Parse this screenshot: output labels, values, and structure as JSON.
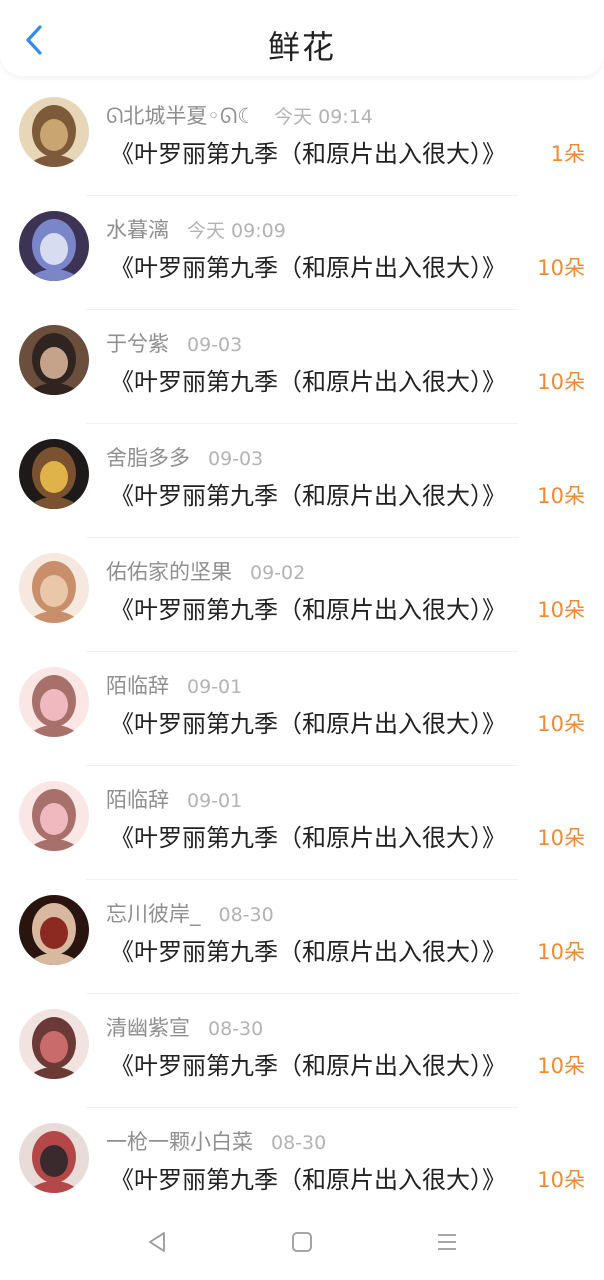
{
  "header": {
    "title": "鲜花",
    "back_icon": "chevron-left-icon",
    "accent": "#2f8cf0"
  },
  "colors": {
    "count": "#f08a33",
    "name": "#8f8f8f",
    "time": "#b3b3b3",
    "message": "#222222"
  },
  "rows": [
    {
      "name": "ᘏ北城半夏◦ᘏ☾",
      "time": "今天 09:14",
      "message": "《叶罗丽第九季（和原片出入很大）》",
      "count": "1朵",
      "avatar_palette": [
        "#e8d6b8",
        "#c9a571",
        "#7d5a3a"
      ]
    },
    {
      "name": "水暮漓",
      "time": "今天 09:09",
      "message": "《叶罗丽第九季（和原片出入很大）》",
      "count": "10朵",
      "avatar_palette": [
        "#3c3355",
        "#d7dcf0",
        "#7b86c8"
      ]
    },
    {
      "name": "于兮紫",
      "time": "09-03",
      "message": "《叶罗丽第九季（和原片出入很大）》",
      "count": "10朵",
      "avatar_palette": [
        "#6b4e3b",
        "#c4a38a",
        "#2f2420"
      ]
    },
    {
      "name": "舍脂多多",
      "time": "09-03",
      "message": "《叶罗丽第九季（和原片出入很大）》",
      "count": "10朵",
      "avatar_palette": [
        "#1f1a1a",
        "#e0b24a",
        "#7a5230"
      ]
    },
    {
      "name": "佑佑家的坚果",
      "time": "09-02",
      "message": "《叶罗丽第九季（和原片出入很大）》",
      "count": "10朵",
      "avatar_palette": [
        "#f6e8de",
        "#e9c7a8",
        "#c98f6b"
      ]
    },
    {
      "name": "陌临辞",
      "time": "09-01",
      "message": "《叶罗丽第九季（和原片出入很大）》",
      "count": "10朵",
      "avatar_palette": [
        "#fbe6e6",
        "#f0b9c0",
        "#a8706b"
      ]
    },
    {
      "name": "陌临辞",
      "time": "09-01",
      "message": "《叶罗丽第九季（和原片出入很大）》",
      "count": "10朵",
      "avatar_palette": [
        "#fbe6e6",
        "#f0b9c0",
        "#a8706b"
      ]
    },
    {
      "name": "忘川彼岸_",
      "time": "08-30",
      "message": "《叶罗丽第九季（和原片出入很大）》",
      "count": "10朵",
      "avatar_palette": [
        "#2a1410",
        "#8c2a22",
        "#d9b8a0"
      ]
    },
    {
      "name": "清幽紫宣",
      "time": "08-30",
      "message": "《叶罗丽第九季（和原片出入很大）》",
      "count": "10朵",
      "avatar_palette": [
        "#f1e4e0",
        "#c96b6b",
        "#6b3a36"
      ]
    },
    {
      "name": "一枪一颗小白菜",
      "time": "08-30",
      "message": "《叶罗丽第九季（和原片出入很大）》",
      "count": "10朵",
      "avatar_palette": [
        "#e8dcd8",
        "#3a2a2e",
        "#b44848"
      ]
    }
  ],
  "nav": {
    "back_icon": "triangle-back-icon",
    "home_icon": "square-home-icon",
    "menu_icon": "hamburger-menu-icon"
  }
}
